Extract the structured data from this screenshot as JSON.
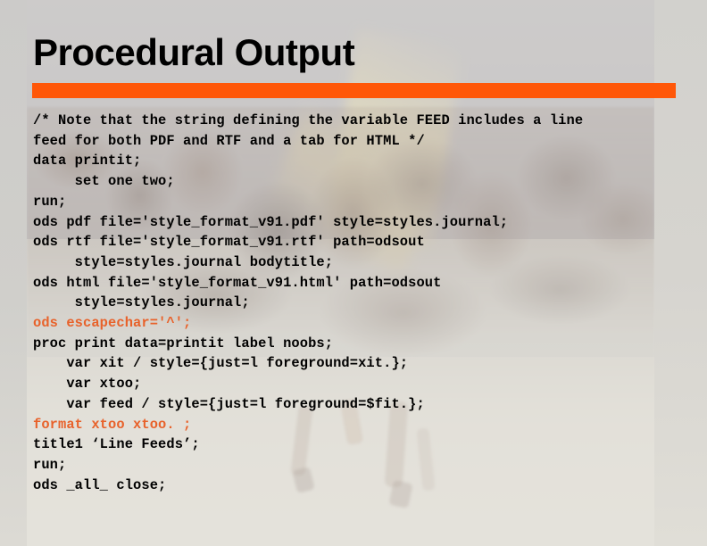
{
  "slide": {
    "title": "Procedural Output",
    "accent_color": "#ff5708",
    "code_accent_color": "#e8622b",
    "background_color": "#c9c9c7",
    "text_color": "#000000"
  },
  "code": {
    "lines": [
      {
        "text": "/* Note that the string defining the variable FEED includes a line",
        "accent": false
      },
      {
        "text": "feed for both PDF and RTF and a tab for HTML */",
        "accent": false
      },
      {
        "text": "data printit;",
        "accent": false
      },
      {
        "text": "     set one two;",
        "accent": false
      },
      {
        "text": "run;",
        "accent": false
      },
      {
        "text": "ods pdf file='style_format_v91.pdf' style=styles.journal;",
        "accent": false
      },
      {
        "text": "ods rtf file='style_format_v91.rtf' path=odsout",
        "accent": false
      },
      {
        "text": "     style=styles.journal bodytitle;",
        "accent": false
      },
      {
        "text": "ods html file='style_format_v91.html' path=odsout",
        "accent": false
      },
      {
        "text": "     style=styles.journal;",
        "accent": false
      },
      {
        "text": "ods escapechar='^';",
        "accent": true
      },
      {
        "text": "proc print data=printit label noobs;",
        "accent": false
      },
      {
        "text": "    var xit / style={just=l foreground=xit.};",
        "accent": false
      },
      {
        "text": "    var xtoo;",
        "accent": false
      },
      {
        "text": "    var feed / style={just=l foreground=$fit.};",
        "accent": false
      },
      {
        "text": "format xtoo xtoo. ;",
        "accent": true
      },
      {
        "text": "title1 ‘Line Feeds’;",
        "accent": false
      },
      {
        "text": "run;",
        "accent": false
      },
      {
        "text": "ods _all_ close;",
        "accent": false
      }
    ]
  }
}
